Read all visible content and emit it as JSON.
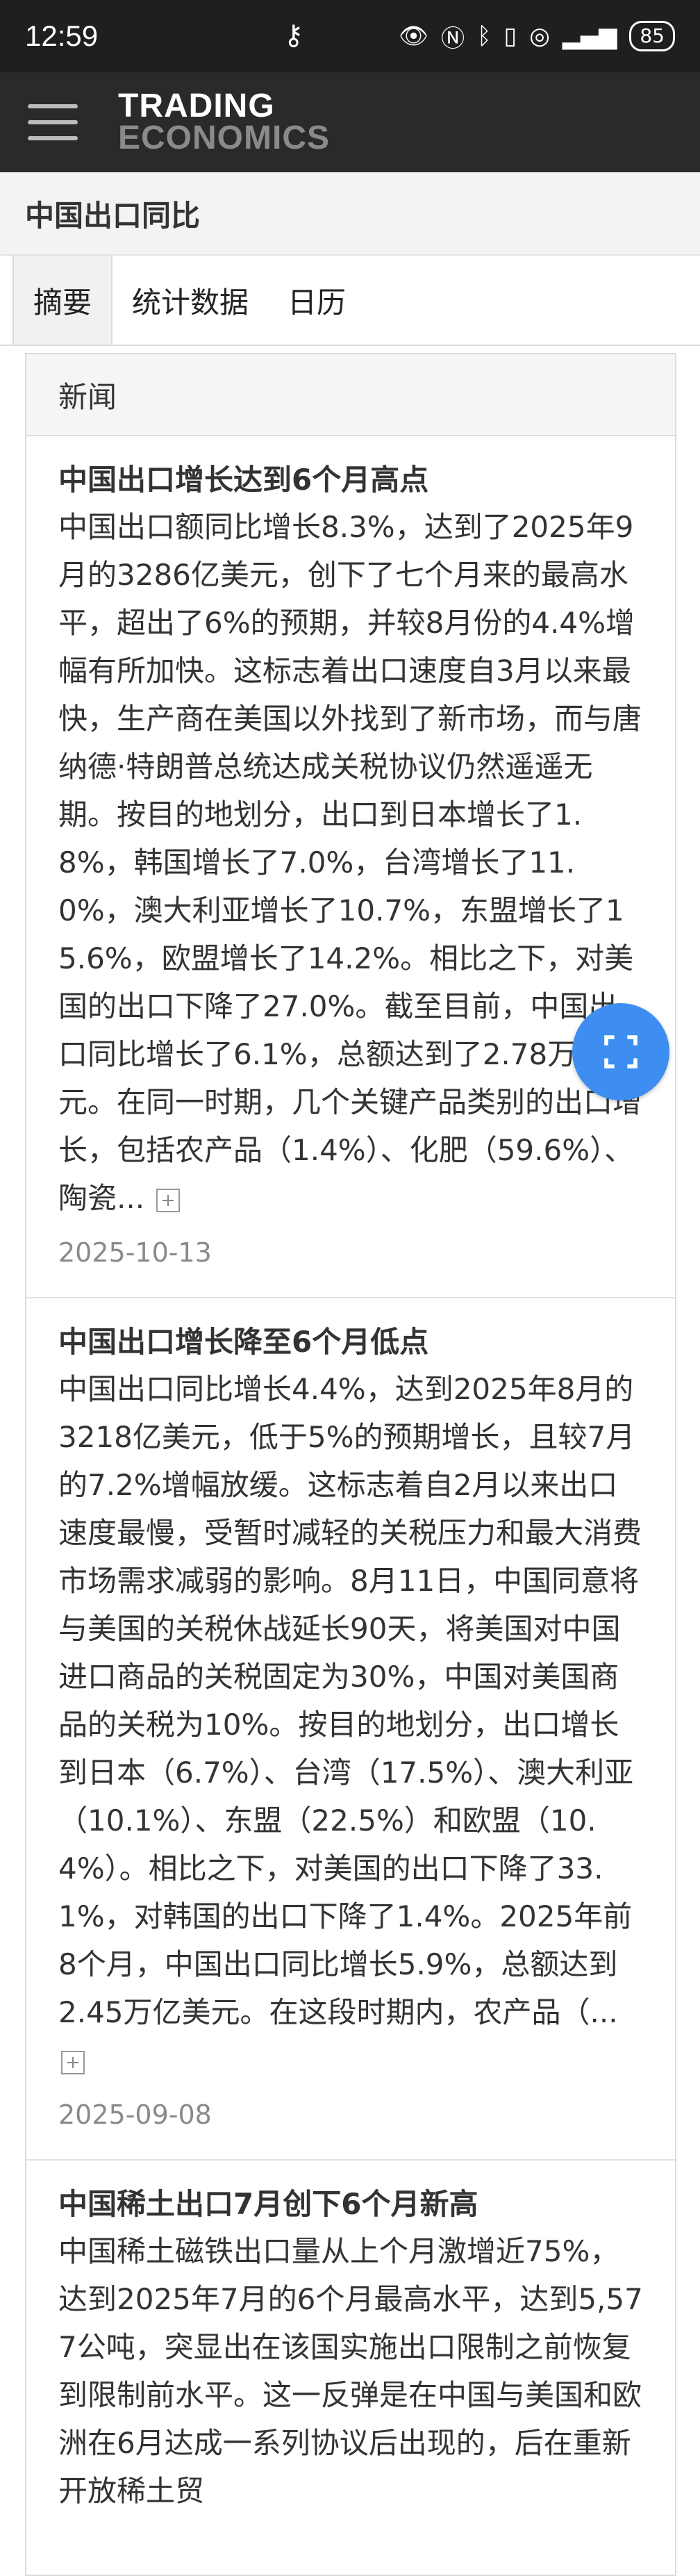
{
  "status_bar": {
    "time": "12:59",
    "battery": "85"
  },
  "app": {
    "logo_line1": "TRADING",
    "logo_line2": "ECONOMICS"
  },
  "page": {
    "title": "中国出口同比"
  },
  "tabs": [
    {
      "label": "摘要",
      "active": true
    },
    {
      "label": "统计数据",
      "active": false
    },
    {
      "label": "日历",
      "active": false
    }
  ],
  "news": {
    "header": "新闻",
    "items": [
      {
        "title": "中国出口增长达到6个月高点",
        "body": "中国出口额同比增长8.3%，达到了2025年9月的3286亿美元，创下了七个月来的最高水平，超出了6%的预期，并较8月份的4.4%增幅有所加快。这标志着出口速度自3月以来最快，生产商在美国以外找到了新市场，而与唐纳德·特朗普总统达成关税协议仍然遥遥无期。按目的地划分，出口到日本增长了1.8%，韩国增长了7.0%，台湾增长了11.0%，澳大利亚增长了10.7%，东盟增长了15.6%，欧盟增长了14.2%。相比之下，对美国的出口下降了27.0%。截至目前，中国出口同比增长了6.1%，总额达到了2.78万亿美元。在同一时期，几个关键产品类别的出口增长，包括农产品（1.4%）、化肥（59.6%）、陶瓷...",
        "date": "2025-10-13"
      },
      {
        "title": "中国出口增长降至6个月低点",
        "body": "中国出口同比增长4.4%，达到2025年8月的3218亿美元，低于5%的预期增长，且较7月的7.2%增幅放缓。这标志着自2月以来出口速度最慢，受暂时减轻的关税压力和最大消费市场需求减弱的影响。8月11日，中国同意将与美国的关税休战延长90天，将美国对中国进口商品的关税固定为30%，中国对美国商品的关税为10%。按目的地划分，出口增长到日本（6.7%）、台湾（17.5%）、澳大利亚（10.1%）、东盟（22.5%）和欧盟（10.4%）。相比之下，对美国的出口下降了33.1%，对韩国的出口下降了1.4%。2025年前8个月，中国出口同比增长5.9%，总额达到2.45万亿美元。在这段时期内，农产品（...",
        "date": "2025-09-08"
      },
      {
        "title": "中国稀土出口7月创下6个月新高",
        "body": "中国稀土磁铁出口量从上个月激增近75%，达到2025年7月的6个月最高水平，达到5,577公吨，突显出在该国实施出口限制之前恢复到限制前水平。这一反弹是在中国与美国和欧洲在6月达成一系列协议后出现的，后在重新开放稀土贸",
        "date": ""
      }
    ]
  }
}
